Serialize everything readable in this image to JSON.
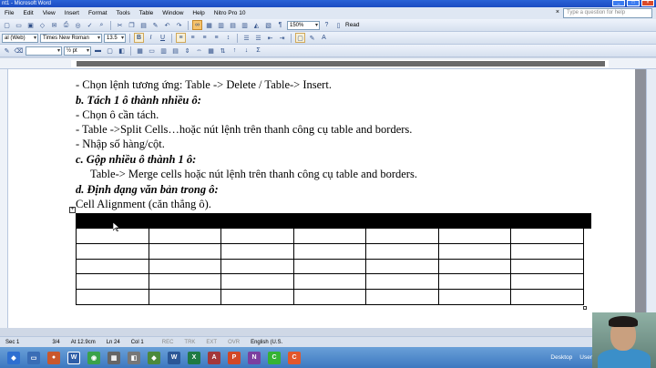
{
  "window": {
    "title": "nt1 - Microsoft Word"
  },
  "menu": {
    "items": [
      "File",
      "Edit",
      "View",
      "Insert",
      "Format",
      "Tools",
      "Table",
      "Window",
      "Help",
      "Nitro Pro 10"
    ],
    "help_placeholder": "Type a question for help",
    "close_glyph": "×"
  },
  "toolbar": {
    "zoom": "150%",
    "read_label": "Read",
    "style": "al (Web)",
    "font": "Times New Roman",
    "size": "13.5",
    "bold": "B",
    "italic": "I",
    "underline": "U",
    "tb3_field": "½ pt"
  },
  "document": {
    "lines": [
      "- Chọn lệnh tương ứng: Table -> Delete / Table-> Insert.",
      "b. Tách 1 ô thành nhiều ô:",
      "- Chọn ô cần tách.",
      "- Table ->Split Cells…hoặc nút lệnh trên thanh công cụ table and borders.",
      "-  Nhập số hàng/cột.",
      "c. Gộp nhiều ô thành 1 ô:",
      "Table-> Merge cells hoặc nút lệnh  trên thanh công cụ table and borders.",
      "d. Định dạng văn bản trong ô:",
      "Cell Alignment (căn thẳng ô)."
    ],
    "table": {
      "rows": 6,
      "cols": 7
    }
  },
  "status": {
    "sec": "Sec 1",
    "page": "3/4",
    "at": "At 12.9cm",
    "ln": "Ln 24",
    "col": "Col 1",
    "rec": "REC",
    "trk": "TRK",
    "ext": "EXT",
    "ovr": "OVR",
    "lang": "English (U.S."
  },
  "taskbar": {
    "desktop": "Desktop",
    "user": "User"
  },
  "colors": {
    "title_blue": "#2a62d6",
    "ui_bg": "#dfe7f3",
    "page_bg": "#ffffff"
  }
}
